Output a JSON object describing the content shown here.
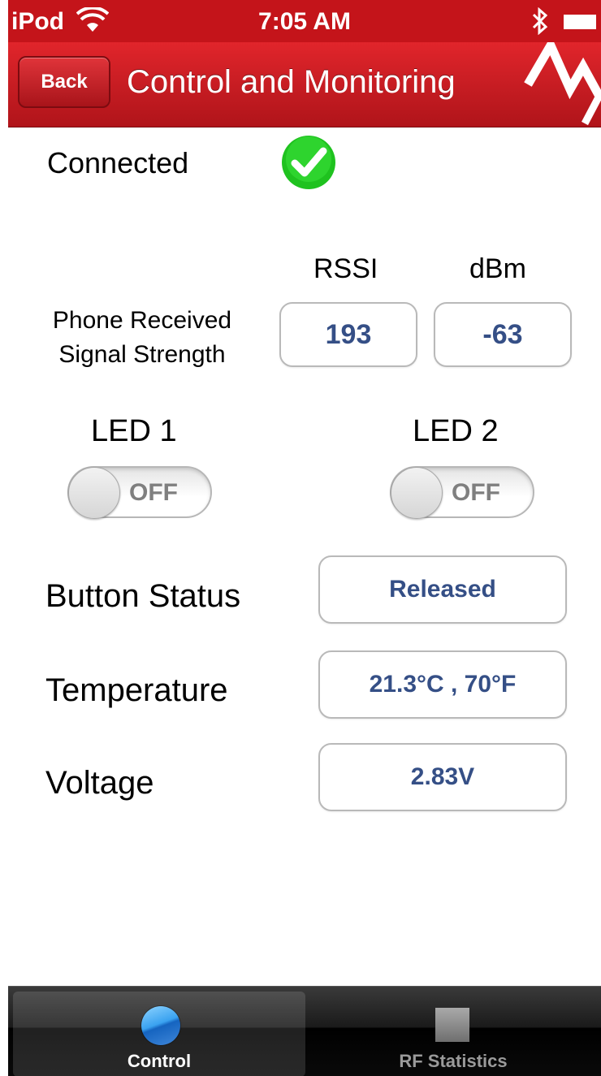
{
  "status_bar": {
    "carrier": "iPod",
    "time": "7:05 AM",
    "wifi_icon": "wifi-icon",
    "bluetooth_icon": "bluetooth-icon",
    "battery_icon": "battery-icon"
  },
  "nav": {
    "back_label": "Back",
    "title": "Control and Monitoring",
    "logo_icon": "brand-logo-icon"
  },
  "connection": {
    "label": "Connected",
    "status_icon": "check-circle-icon",
    "status_color": "#1fc21f"
  },
  "signal": {
    "label_line1": "Phone Received",
    "label_line2": "Signal Strength",
    "rssi_header": "RSSI",
    "dbm_header": "dBm",
    "rssi_value": "193",
    "dbm_value": "-63"
  },
  "leds": [
    {
      "label": "LED 1",
      "state": "OFF"
    },
    {
      "label": "LED 2",
      "state": "OFF"
    }
  ],
  "readings": {
    "button_status_label": "Button Status",
    "button_status_value": "Released",
    "temperature_label": "Temperature",
    "temperature_value": "21.3°C , 70°F",
    "voltage_label": "Voltage",
    "voltage_value": "2.83V"
  },
  "tabs": [
    {
      "label": "Control",
      "icon": "circle-icon",
      "selected": true
    },
    {
      "label": "RF Statistics",
      "icon": "square-icon",
      "selected": false
    }
  ],
  "colors": {
    "brand_red": "#c51c22",
    "value_text": "#354f86"
  }
}
